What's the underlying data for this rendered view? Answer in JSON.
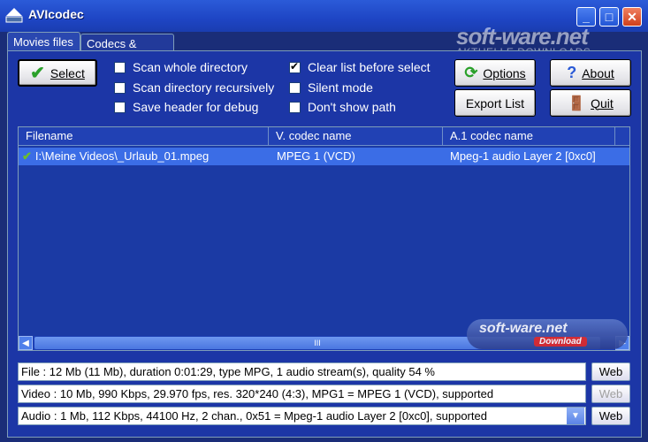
{
  "window": {
    "title": "AVIcodec"
  },
  "watermark": {
    "main": "soft-ware.net",
    "sub": "AKTUELLE DOWNLOADS"
  },
  "tabs": [
    {
      "label": "Movies files"
    },
    {
      "label": "Codecs & Filters"
    }
  ],
  "toolbar": {
    "select_label": "Select",
    "options_label": "Options",
    "about_label": "About",
    "export_label": "Export List",
    "quit_label": "Quit"
  },
  "options": [
    {
      "label": "Scan whole directory",
      "checked": false
    },
    {
      "label": "Scan directory recursively",
      "checked": false
    },
    {
      "label": "Save header for debug",
      "checked": false
    },
    {
      "label": "Clear list before select",
      "checked": true
    },
    {
      "label": "Silent mode",
      "checked": false
    },
    {
      "label": "Don't show path",
      "checked": false
    }
  ],
  "list": {
    "columns": [
      "Filename",
      "V. codec name",
      "A.1 codec name"
    ],
    "rows": [
      {
        "filename": "I:\\Meine Videos\\_Urlaub_01.mpeg",
        "vcodec": "MPEG 1 (VCD)",
        "acodec": "Mpeg-1 audio Layer 2 [0xc0]",
        "ok": true
      }
    ],
    "scroll_thumb_text": "III"
  },
  "badge": {
    "text": "soft-ware.net",
    "sub": "Download"
  },
  "info": {
    "file": "File : 12 Mb (11 Mb), duration 0:01:29, type MPG, 1 audio stream(s), quality 54 %",
    "video": "Video : 10 Mb, 990 Kbps, 29.970 fps, res. 320*240 (4:3),  MPG1 = MPEG 1 (VCD), supported",
    "audio": "Audio : 1 Mb, 112 Kbps, 44100 Hz, 2 chan., 0x51 = Mpeg-1 audio Layer 2 [0xc0], supported",
    "web_label": "Web"
  },
  "colors": {
    "title_bar": "#2356d6",
    "panel": "#1c36a6",
    "selection": "#3b6de6"
  }
}
